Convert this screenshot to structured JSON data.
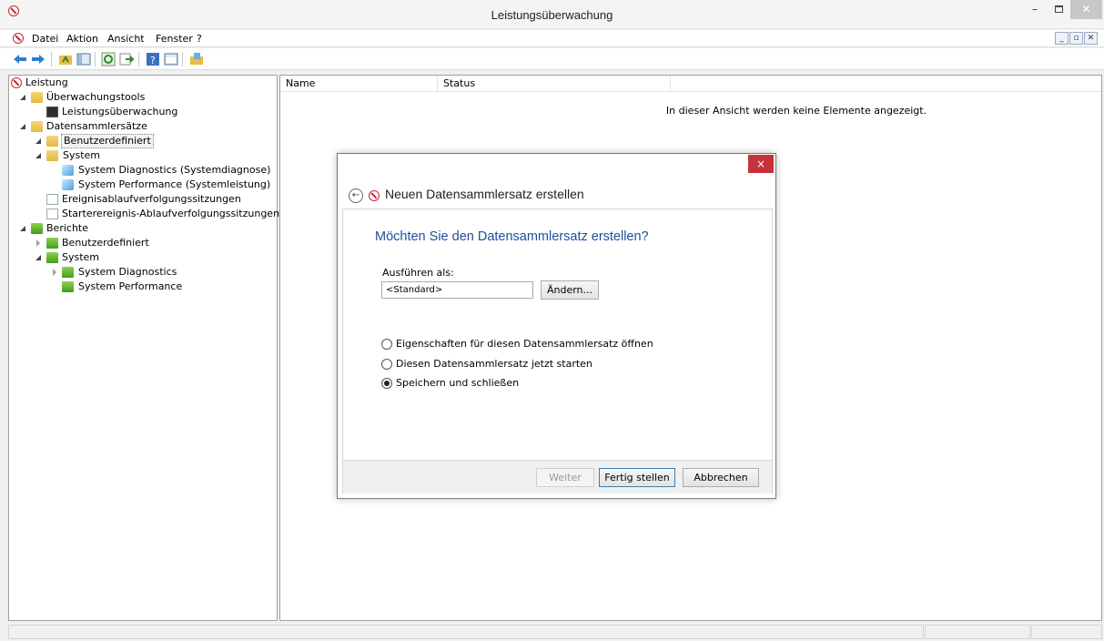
{
  "window": {
    "title": "Leistungsüberwachung"
  },
  "menu": {
    "items": [
      "Datei",
      "Aktion",
      "Ansicht",
      "Fenster",
      "?"
    ]
  },
  "tree": {
    "root": "Leistung",
    "monitoring_tools": "Überwachungstools",
    "performance_monitor": "Leistungsüberwachung",
    "collector_sets": "Datensammlersätze",
    "user_defined": "Benutzerdefiniert",
    "system": "System",
    "system_diagnostics": "System Diagnostics (Systemdiagnose)",
    "system_performance": "System Performance (Systemleistung)",
    "event_trace_sessions": "Ereignisablaufverfolgungssitzungen",
    "startup_trace_sessions": "Starterereignis-Ablaufverfolgungssitzungen",
    "reports": "Berichte",
    "reports_user_defined": "Benutzerdefiniert",
    "reports_system": "System",
    "reports_system_diagnostics": "System Diagnostics",
    "reports_system_performance": "System Performance"
  },
  "list": {
    "columns": [
      "Name",
      "Status"
    ],
    "empty_message": "In dieser Ansicht werden keine Elemente angezeigt."
  },
  "dialog": {
    "close": "×",
    "title": "Neuen Datensammlersatz erstellen",
    "heading": "Möchten Sie den Datensammlersatz erstellen?",
    "run_as_label": "Ausführen als:",
    "run_as_value": "<Standard>",
    "change_button": "Ändern...",
    "options": [
      "Eigenschaften für diesen Datensammlersatz öffnen",
      "Diesen Datensammlersatz jetzt starten",
      "Speichern und schließen"
    ],
    "selected_option": 2,
    "next_button": "Weiter",
    "finish_button": "Fertig stellen",
    "cancel_button": "Abbrechen"
  }
}
